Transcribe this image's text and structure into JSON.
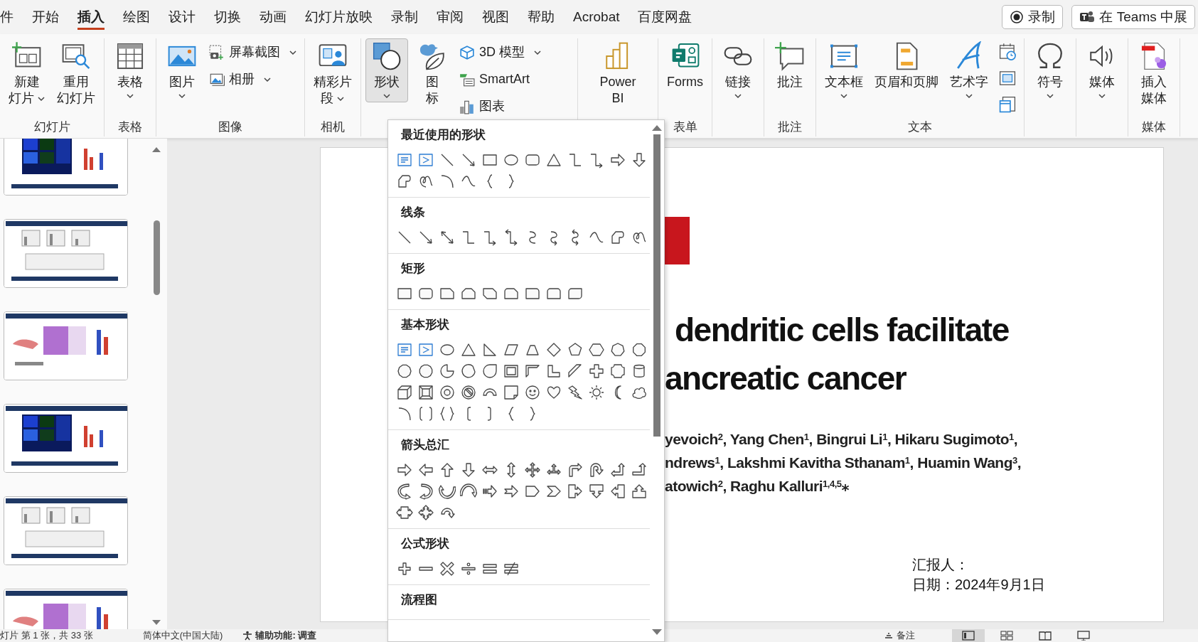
{
  "tabs": [
    {
      "label": "件",
      "selected": false
    },
    {
      "label": "开始",
      "selected": false
    },
    {
      "label": "插入",
      "selected": true
    },
    {
      "label": "绘图",
      "selected": false
    },
    {
      "label": "设计",
      "selected": false
    },
    {
      "label": "切换",
      "selected": false
    },
    {
      "label": "动画",
      "selected": false
    },
    {
      "label": "幻灯片放映",
      "selected": false
    },
    {
      "label": "录制",
      "selected": false
    },
    {
      "label": "审阅",
      "selected": false
    },
    {
      "label": "视图",
      "selected": false
    },
    {
      "label": "帮助",
      "selected": false
    },
    {
      "label": "Acrobat",
      "selected": false
    },
    {
      "label": "百度网盘",
      "selected": false
    }
  ],
  "top_buttons": [
    {
      "kind": "record",
      "label": "录制"
    },
    {
      "kind": "teams",
      "label": "在 Teams 中展"
    }
  ],
  "ribbon_groups": [
    {
      "label": "幻灯片",
      "items": [
        {
          "kind": "large",
          "lines": [
            "新建",
            "灯片"
          ],
          "dropdown": true
        },
        {
          "kind": "large",
          "lines": [
            "重用",
            "幻灯片"
          ],
          "dropdown": false
        }
      ]
    },
    {
      "label": "表格",
      "items": [
        {
          "kind": "large",
          "lines": [
            "表格"
          ],
          "dropdown": true
        }
      ]
    },
    {
      "label": "图像",
      "items": [
        {
          "kind": "large",
          "lines": [
            "图片"
          ],
          "dropdown": true
        },
        {
          "kind": "stack",
          "items": [
            {
              "label": "屏幕截图",
              "dropdown": true
            },
            {
              "label": "相册",
              "dropdown": true
            }
          ]
        }
      ]
    },
    {
      "label": "相机",
      "items": [
        {
          "kind": "large",
          "lines": [
            "精彩片",
            "段"
          ],
          "dropdown": true
        }
      ]
    },
    {
      "items": [
        {
          "kind": "large",
          "lines": [
            "形状"
          ],
          "dropdown": true,
          "pressed": true
        },
        {
          "kind": "large",
          "lines": [
            "图",
            "标"
          ],
          "dropdown": false
        },
        {
          "kind": "stack",
          "items": [
            {
              "label": "3D 模型",
              "dropdown": true
            },
            {
              "label": "SmartArt",
              "dropdown": false
            },
            {
              "label": "图表",
              "dropdown": false
            }
          ]
        }
      ]
    },
    {
      "items": [
        {
          "kind": "large",
          "lines": [
            "Power",
            "BI"
          ],
          "dropdown": false
        }
      ]
    },
    {
      "label": "表单",
      "items": [
        {
          "kind": "large",
          "lines": [
            "Forms"
          ],
          "dropdown": false
        }
      ]
    },
    {
      "items": [
        {
          "kind": "large",
          "lines": [
            "链接"
          ],
          "dropdown": true
        }
      ]
    },
    {
      "label": "批注",
      "items": [
        {
          "kind": "large",
          "lines": [
            "批注"
          ],
          "dropdown": false
        }
      ]
    },
    {
      "label": "文本",
      "items": [
        {
          "kind": "large",
          "lines": [
            "文本框"
          ],
          "dropdown": true
        },
        {
          "kind": "large",
          "lines": [
            "页眉和页脚"
          ],
          "dropdown": false
        },
        {
          "kind": "large",
          "lines": [
            "艺术字"
          ],
          "dropdown": true
        },
        {
          "kind": "icons",
          "items": [
            {
              "kind": "icon"
            },
            {
              "kind": "icon"
            },
            {
              "kind": "icon"
            }
          ]
        }
      ]
    },
    {
      "items": [
        {
          "kind": "large",
          "lines": [
            "符号"
          ],
          "dropdown": true
        }
      ]
    },
    {
      "items": [
        {
          "kind": "large",
          "lines": [
            "媒体"
          ],
          "dropdown": true
        }
      ]
    },
    {
      "label": "媒体",
      "items": [
        {
          "kind": "large",
          "lines": [
            "插入",
            "媒体"
          ],
          "dropdown": false
        }
      ]
    }
  ],
  "shape_gallery": {
    "sections": [
      {
        "title": "最近使用的形状"
      },
      {
        "title": "线条"
      },
      {
        "title": "矩形"
      },
      {
        "title": "基本形状"
      },
      {
        "title": "箭头总汇"
      },
      {
        "title": "公式形状"
      },
      {
        "title": "流程图"
      }
    ]
  },
  "slide": {
    "title_lines": [
      "dendritic cells facilitate",
      "ancreatic cancer"
    ],
    "author_lines": [
      "yevoich$^{2}$, Yang Chen$^{1}$, Bingrui Li$^{1}$, Hikaru Sugimoto$^{1}$,",
      "ndrews$^{1}$, Lakshmi Kavitha Sthanam$^{1}$, Huamin Wang$^{3}$,",
      "atowich$^{2}$, Raghu Kalluri$^{1,4,5}$⁎"
    ],
    "reporter": "汇报人：",
    "date": "日期：2024年9月1日"
  },
  "status_bar": {
    "slide_info": "灯片 第 1 张，共 33 张",
    "language": "简体中文(中国大陆)",
    "accessibility": "辅助功能: 调查",
    "notes": "备注",
    "views": [
      {
        "selected": true
      },
      {
        "selected": false
      },
      {
        "selected": false
      },
      {
        "selected": false
      }
    ]
  }
}
